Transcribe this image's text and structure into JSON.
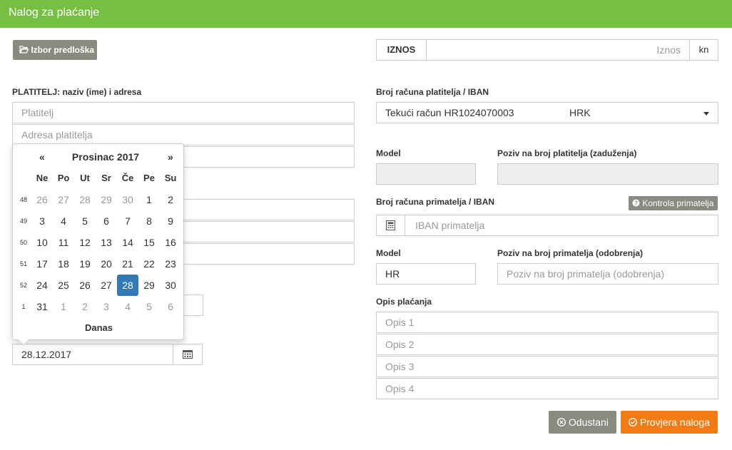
{
  "header": {
    "title": "Nalog za plaćanje"
  },
  "template_button": {
    "label": "Izbor predloška",
    "icon": "folder-open-icon"
  },
  "amount": {
    "label": "IZNOS",
    "placeholder": "Iznos",
    "unit": "kn"
  },
  "payer": {
    "section_label": "PLATITELJ: naziv (ime) i adresa",
    "name_placeholder": "Platitelj",
    "address_placeholder": "Adresa platitelja"
  },
  "payer_account": {
    "label": "Broj računa platitelja / IBAN",
    "selected_account": "Tekući račun HR1024070003",
    "selected_currency": "HRK"
  },
  "payer_model": {
    "label": "Model"
  },
  "payer_reference": {
    "label": "Poziv na broj platitelja (zaduženja)"
  },
  "recipient_account": {
    "label": "Broj računa primatelja / IBAN",
    "check_button": "Kontrola primatelja",
    "placeholder": "IBAN primatelja"
  },
  "recipient_model": {
    "label": "Model",
    "value": "HR"
  },
  "recipient_reference": {
    "label": "Poziv na broj primatelja (odobrenja)",
    "placeholder": "Poziv na broj primatelja (odobrenja)"
  },
  "description": {
    "label": "Opis plaćanja",
    "placeholders": [
      "Opis 1",
      "Opis 2",
      "Opis 3",
      "Opis 4"
    ]
  },
  "date_field": {
    "value": "28.12.2017"
  },
  "datepicker": {
    "prev": "«",
    "next": "»",
    "month_title": "Prosinac 2017",
    "weekdays": [
      "Ne",
      "Po",
      "Ut",
      "Sr",
      "Če",
      "Pe",
      "Su"
    ],
    "weeks": [
      {
        "wk": "48",
        "days": [
          "26",
          "27",
          "28",
          "29",
          "30",
          "1",
          "2"
        ]
      },
      {
        "wk": "49",
        "days": [
          "3",
          "4",
          "5",
          "6",
          "7",
          "8",
          "9"
        ]
      },
      {
        "wk": "50",
        "days": [
          "10",
          "11",
          "12",
          "13",
          "14",
          "15",
          "16"
        ]
      },
      {
        "wk": "51",
        "days": [
          "17",
          "18",
          "19",
          "20",
          "21",
          "22",
          "23"
        ]
      },
      {
        "wk": "52",
        "days": [
          "24",
          "25",
          "26",
          "27",
          "28",
          "29",
          "30"
        ]
      },
      {
        "wk": "1",
        "days": [
          "31",
          "1",
          "2",
          "3",
          "4",
          "5",
          "6"
        ]
      }
    ],
    "selected": "28",
    "today_label": "Danas"
  },
  "actions": {
    "cancel": "Odustani",
    "verify": "Provjera naloga"
  },
  "colors": {
    "header": "#77bf43",
    "primary": "#f47b14",
    "secondary": "#8a8a80",
    "selected_day": "#337ab7"
  }
}
